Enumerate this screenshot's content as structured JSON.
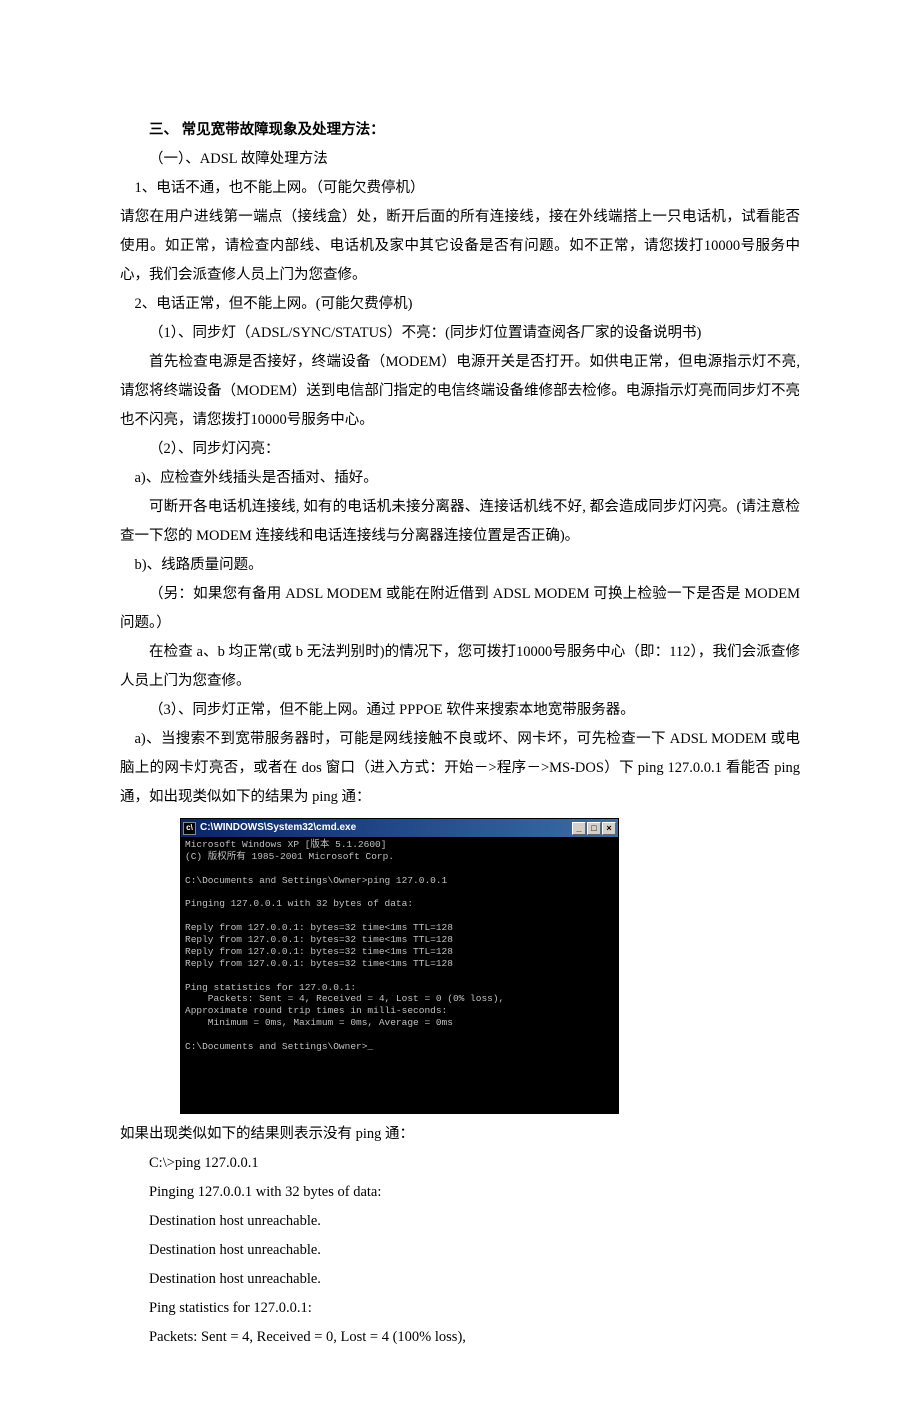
{
  "heading": "三、 常见宽带故障现象及处理方法：",
  "s1_title": "（一）、ADSL 故障处理方法",
  "p1": "1、电话不通，也不能上网。（可能欠费停机）",
  "p2": "请您在用户进线第一端点（接线盒）处，断开后面的所有连接线，接在外线端搭上一只电话机，试看能否使用。如正常，请检查内部线、电话机及家中其它设备是否有问题。如不正常，请您拨打10000号服务中心，我们会派查修人员上门为您查修。",
  "p3": "2、电话正常，但不能上网。(可能欠费停机)",
  "p4": "（1）、同步灯（ADSL/SYNC/STATUS）不亮：(同步灯位置请查阅各厂家的设备说明书)",
  "p5": "首先检查电源是否接好，终端设备（MODEM）电源开关是否打开。如供电正常，但电源指示灯不亮,请您将终端设备（MODEM）送到电信部门指定的电信终端设备维修部去检修。电源指示灯亮而同步灯不亮也不闪亮，请您拨打10000号服务中心。",
  "p6": "（2）、同步灯闪亮：",
  "p7": "a)、应检查外线插头是否插对、插好。",
  "p8": "可断开各电话机连接线,  如有的电话机未接分离器、连接话机线不好,  都会造成同步灯闪亮。(请注意检查一下您的 MODEM 连接线和电话连接线与分离器连接位置是否正确)。",
  "p9": "b)、线路质量问题。",
  "p10": "（另：如果您有备用 ADSL MODEM 或能在附近借到 ADSL MODEM 可换上检验一下是否是 MODEM问题。）",
  "p11": "在检查 a、b 均正常(或 b 无法判别时)的情况下，您可拨打10000号服务中心（即：112），我们会派查修人员上门为您查修。",
  "p12": "（3）、同步灯正常，但不能上网。通过 PPPOE 软件来搜索本地宽带服务器。",
  "p13": "a)、当搜索不到宽带服务器时，可能是网线接触不良或坏、网卡坏，可先检查一下 ADSL MODEM 或电脑上的网卡灯亮否，或者在 dos 窗口（进入方式：开始－>程序－>MS-DOS）下 ping 127.0.0.1 看能否 ping通，如出现类似如下的结果为 ping 通：",
  "cmd": {
    "title": "C:\\WINDOWS\\System32\\cmd.exe",
    "body": "Microsoft Windows XP [版本 5.1.2600]\n(C) 版权所有 1985-2001 Microsoft Corp.\n\nC:\\Documents and Settings\\Owner>ping 127.0.0.1\n\nPinging 127.0.0.1 with 32 bytes of data:\n\nReply from 127.0.0.1: bytes=32 time<1ms TTL=128\nReply from 127.0.0.1: bytes=32 time<1ms TTL=128\nReply from 127.0.0.1: bytes=32 time<1ms TTL=128\nReply from 127.0.0.1: bytes=32 time<1ms TTL=128\n\nPing statistics for 127.0.0.1:\n    Packets: Sent = 4, Received = 4, Lost = 0 (0% loss),\nApproximate round trip times in milli-seconds:\n    Minimum = 0ms, Maximum = 0ms, Average = 0ms\n\nC:\\Documents and Settings\\Owner>_"
  },
  "p14": "如果出现类似如下的结果则表示没有 ping 通：",
  "fail": {
    "l1": "C:\\>ping 127.0.0.1",
    "l2": "Pinging 127.0.0.1 with 32 bytes of data:",
    "l3": "Destination host unreachable.",
    "l4": "Destination host unreachable.",
    "l5": "Destination host unreachable.",
    "l6": "Ping statistics for 127.0.0.1:",
    "l7": "Packets: Sent = 4, Received = 0, Lost = 4 (100% loss),"
  },
  "winbtns": {
    "min": "_",
    "max": "□",
    "close": "×"
  }
}
